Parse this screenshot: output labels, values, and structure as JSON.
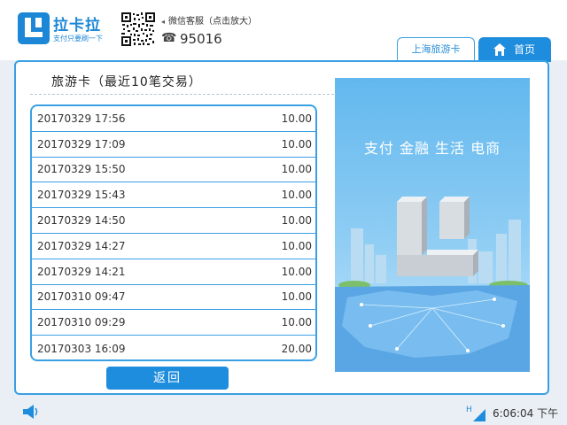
{
  "brand": {
    "name": "拉卡拉",
    "slogan": "支付只要刷一下",
    "accent": "#1b87d6"
  },
  "header": {
    "wechat_label": "微信客服（点击放大）",
    "wechat_arrow": "◂",
    "phone_icon": "☎",
    "phone": "95016"
  },
  "tabs": [
    {
      "label": "上海旅游卡",
      "active": true
    },
    {
      "label": "首页",
      "icon": "home-icon",
      "active": false
    }
  ],
  "section": {
    "title": "旅游卡（最近10笔交易）"
  },
  "transactions": [
    {
      "time": "20170329 17:56",
      "amount": "10.00"
    },
    {
      "time": "20170329 17:09",
      "amount": "10.00"
    },
    {
      "time": "20170329 15:50",
      "amount": "10.00"
    },
    {
      "time": "20170329 15:43",
      "amount": "10.00"
    },
    {
      "time": "20170329 14:50",
      "amount": "10.00"
    },
    {
      "time": "20170329 14:27",
      "amount": "10.00"
    },
    {
      "time": "20170329 14:21",
      "amount": "10.00"
    },
    {
      "time": "20170310 09:47",
      "amount": "10.00"
    },
    {
      "time": "20170310 09:29",
      "amount": "10.00"
    },
    {
      "time": "20170303 16:09",
      "amount": "20.00"
    }
  ],
  "actions": {
    "back_label": "返回"
  },
  "banner": {
    "text": "支付 金融 生活 电商"
  },
  "footer": {
    "speaker_icon": "speaker-icon",
    "signal_icon": "signal-icon",
    "signal_label": "H",
    "clock": "6:06:04 下午"
  },
  "colors": {
    "primary_blue": "#1f8ddd",
    "border_blue": "#3aa0e4",
    "background": "#e9eff4"
  }
}
